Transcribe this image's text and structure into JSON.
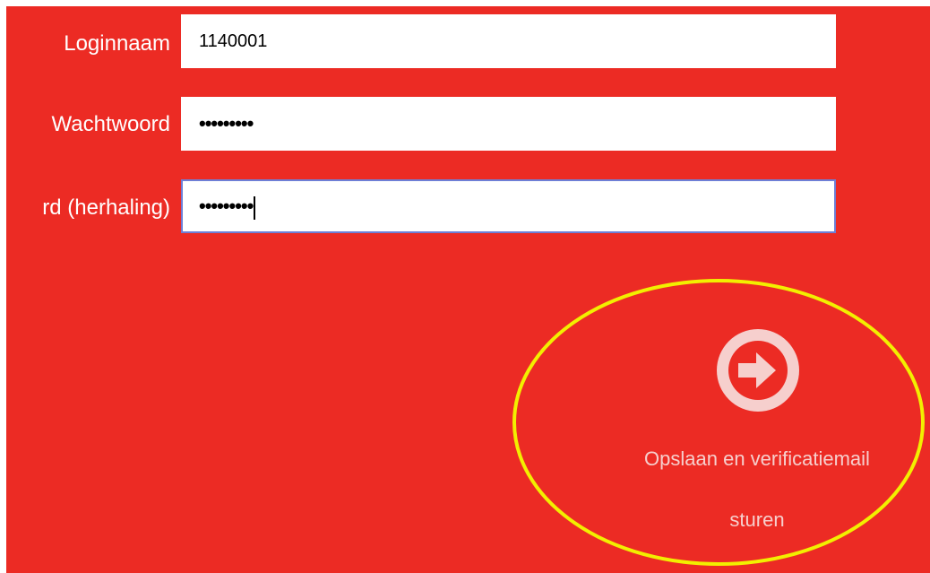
{
  "form": {
    "login": {
      "label": "Loginnaam",
      "value": "1140001"
    },
    "password": {
      "label": "Wachtwoord",
      "value": "•••••••••"
    },
    "password_repeat": {
      "label": "rd (herhaling)",
      "value": "•••••••••"
    }
  },
  "submit": {
    "label_line1": "Opslaan en verificatiemail",
    "label_line2": "sturen",
    "icon": "arrow-right-circle-icon"
  },
  "colors": {
    "background": "#ec2b24",
    "highlight": "#f2ef00",
    "icon": "#f6cfcd",
    "focus_border": "#6e7fd6"
  }
}
